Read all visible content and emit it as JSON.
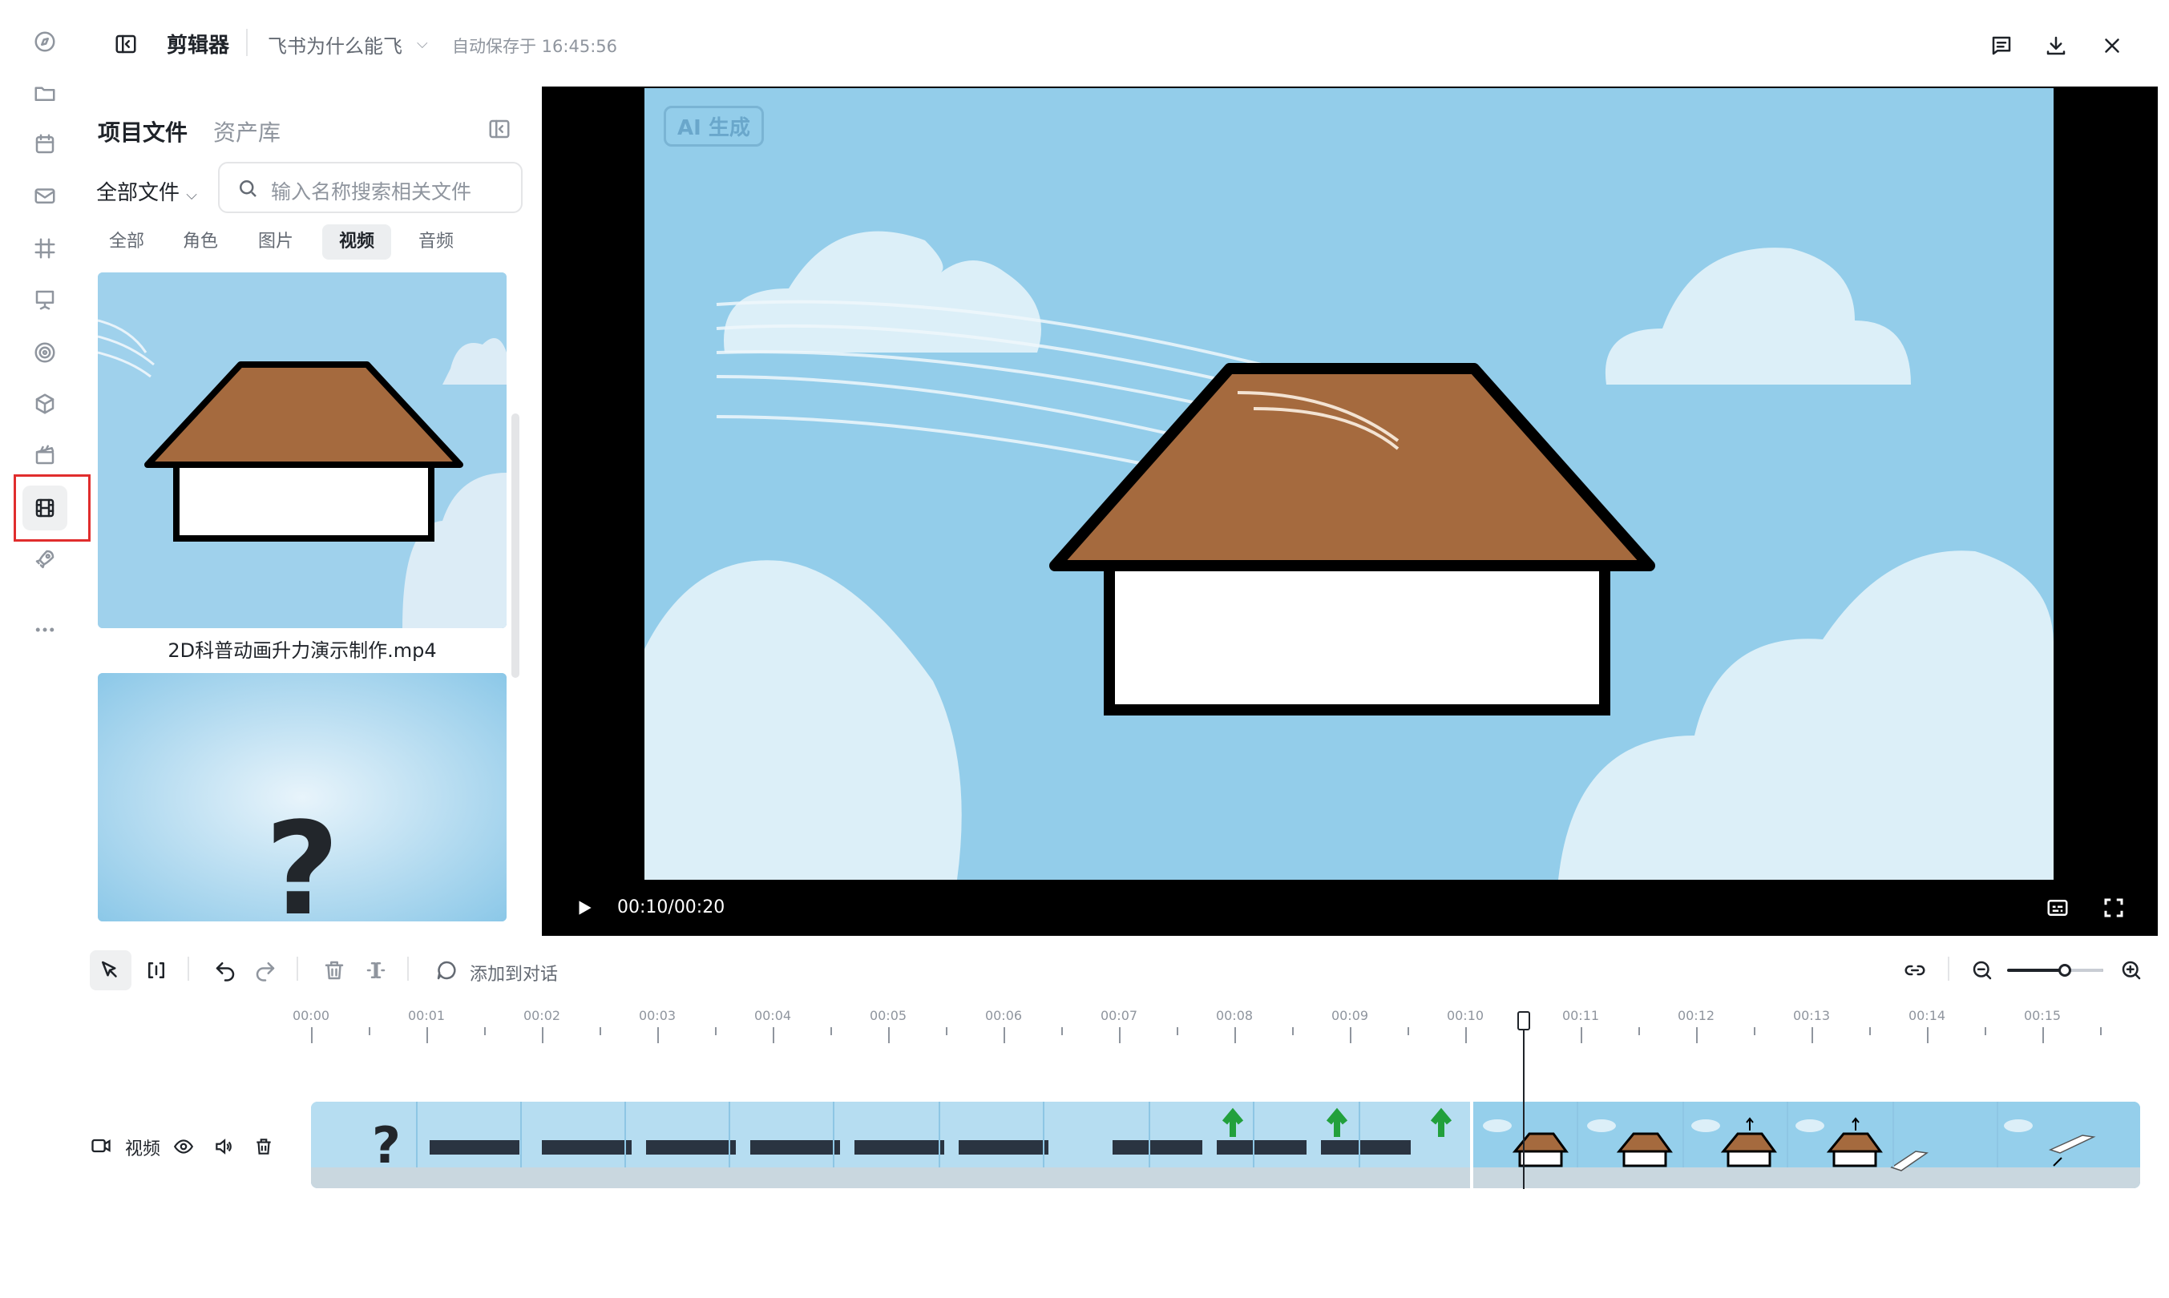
{
  "rail": {
    "icons": [
      "compass-icon",
      "folder-icon",
      "calendar-icon",
      "mail-icon",
      "grid-hash-icon",
      "presentation-icon",
      "target-icon",
      "cube-icon",
      "clapper-icon",
      "film-icon",
      "rocket-icon",
      "more-icon"
    ],
    "active": "film-icon"
  },
  "header": {
    "app_title": "剪辑器",
    "project_name": "飞书为什么能飞",
    "autosave": "自动保存于 16:45:56"
  },
  "panel": {
    "tabs": [
      "项目文件",
      "资产库"
    ],
    "filter_label": "全部文件",
    "search_placeholder": "输入名称搜索相关文件",
    "chips": [
      "全部",
      "角色",
      "图片",
      "视频",
      "音频"
    ],
    "active_chip": "视频",
    "files": [
      {
        "name": "2D科普动画升力演示制作.mp4"
      }
    ]
  },
  "player": {
    "watermark": "AI 生成",
    "time": "00:10/00:20"
  },
  "toolbar": {
    "add_to_chat": "添加到对话",
    "zoom_level": 0.6
  },
  "timeline": {
    "ticks": [
      "00:00",
      "00:01",
      "00:02",
      "00:03",
      "00:04",
      "00:05",
      "00:06",
      "00:07",
      "00:08",
      "00:09",
      "00:10",
      "00:11",
      "00:12",
      "00:13",
      "00:14",
      "00:15"
    ],
    "playhead_time": "00:10.5",
    "track_label": "视频"
  },
  "colors": {
    "accent_red": "#e02d2d",
    "sky": "#93cdea",
    "roof": "#a56a3e"
  }
}
